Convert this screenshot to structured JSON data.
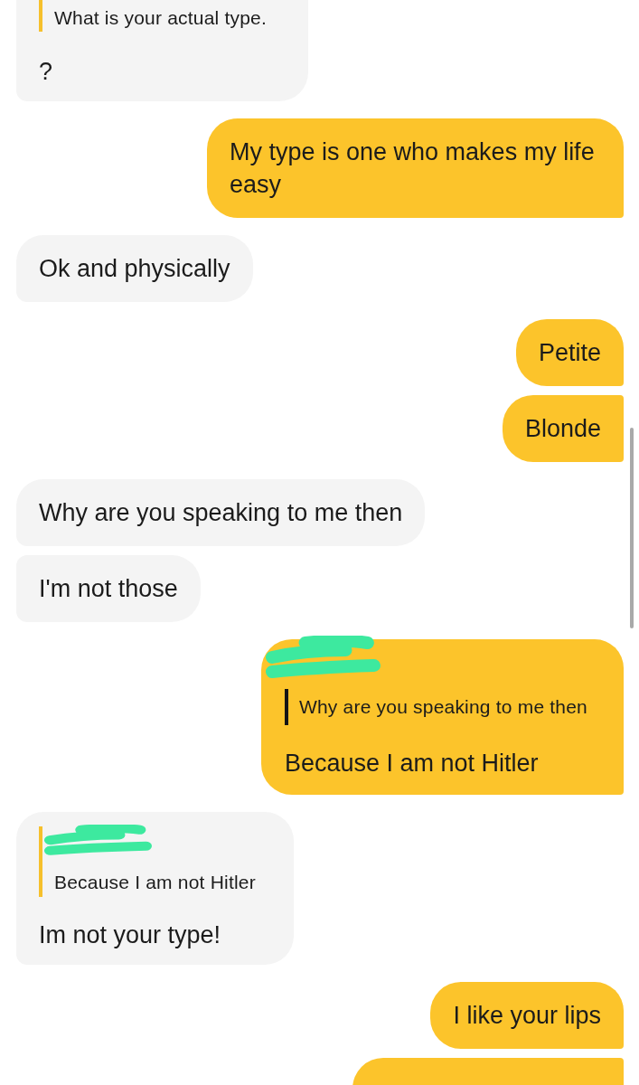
{
  "messages": [
    {
      "kind": "received",
      "cut_off": true,
      "quote": {
        "author_redacted": false,
        "text": "What is your actual type."
      },
      "text": "?"
    },
    {
      "kind": "sent",
      "cut_off": false,
      "text": "My type is one who makes my life easy"
    },
    {
      "kind": "received",
      "cut_off": false,
      "text": "Ok and physically"
    },
    {
      "kind": "sent",
      "cut_off": false,
      "text": "Petite"
    },
    {
      "kind": "sent",
      "cut_off": false,
      "text": "Blonde"
    },
    {
      "kind": "received",
      "cut_off": false,
      "text": "Why are you speaking to me then"
    },
    {
      "kind": "received",
      "cut_off": false,
      "text": "I'm not those"
    },
    {
      "kind": "sent",
      "cut_off": false,
      "quote": {
        "author_redacted": true,
        "text": "Why are you speaking to me then"
      },
      "text": "Because I am not Hitler"
    },
    {
      "kind": "received",
      "cut_off": false,
      "quote": {
        "author_redacted": true,
        "text": "Because I am not Hitler"
      },
      "text": "Im not your type!"
    },
    {
      "kind": "sent",
      "cut_off": false,
      "text": "I like your lips"
    },
    {
      "kind": "sent",
      "cut_off": true
    }
  ]
}
